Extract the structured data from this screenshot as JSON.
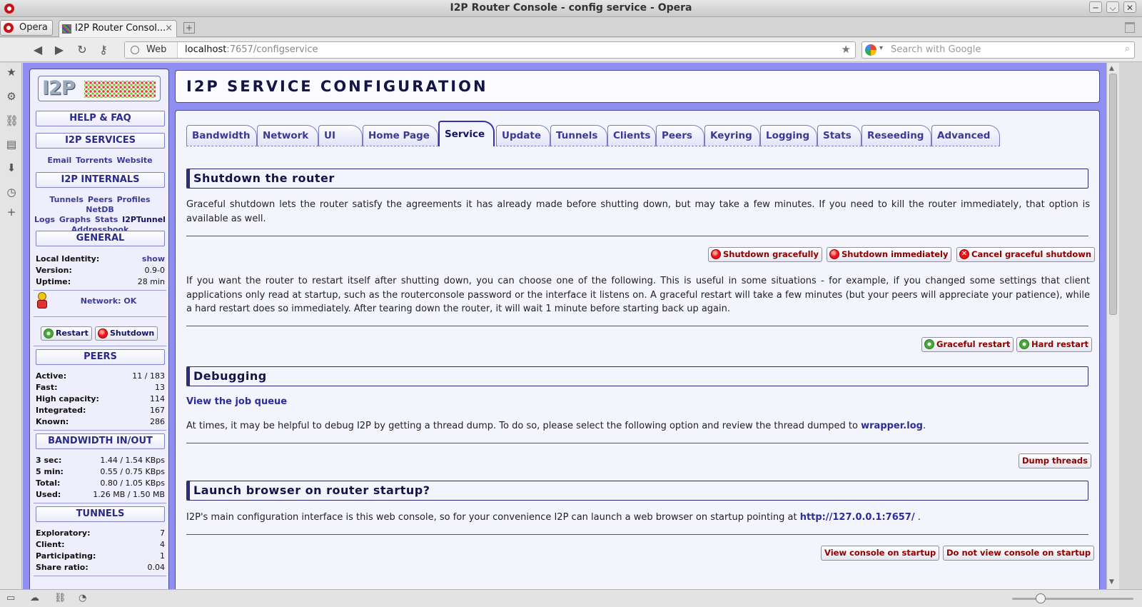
{
  "window": {
    "title": "I2P Router Console - config service - Opera",
    "controls": [
      "─",
      "⌵",
      "✕"
    ]
  },
  "browser": {
    "menu_label": "Opera",
    "tab_title": "I2P Router Consol...",
    "tab_close": "×",
    "new_tab": "+",
    "web_chip": "Web",
    "url_host": "localhost",
    "url_rest": ":7657/configservice",
    "search_placeholder": "Search with Google",
    "nav_icons": [
      "back-icon",
      "forward-icon",
      "reload-icon",
      "key-icon"
    ],
    "panel_icons": [
      "bookmarks-icon",
      "settings-icon",
      "links-icon",
      "notes-icon",
      "downloads-icon",
      "history-icon",
      "add-panel-icon"
    ]
  },
  "sidebar": {
    "help_faq": "HELP & FAQ",
    "services_header": "I2P SERVICES",
    "services": [
      "Email",
      "Torrents",
      "Website"
    ],
    "internals_header": "I2P INTERNALS",
    "internals_row1": [
      "Tunnels",
      "Peers",
      "Profiles",
      "NetDB"
    ],
    "internals_row2": [
      "Logs",
      "Graphs",
      "Stats",
      "I2PTunnel"
    ],
    "internals_row3": [
      "Addressbook"
    ],
    "general_header": "GENERAL",
    "general": [
      {
        "label": "Local Identity:",
        "value": "show"
      },
      {
        "label": "Version:",
        "value": "0.9-0"
      },
      {
        "label": "Uptime:",
        "value": "28 min"
      }
    ],
    "network_status": "Network: OK",
    "restart_label": "Restart",
    "shutdown_label": "Shutdown",
    "peers_header": "PEERS",
    "peers": [
      {
        "label": "Active:",
        "value": "11 / 183"
      },
      {
        "label": "Fast:",
        "value": "13"
      },
      {
        "label": "High capacity:",
        "value": "114"
      },
      {
        "label": "Integrated:",
        "value": "167"
      },
      {
        "label": "Known:",
        "value": "286"
      }
    ],
    "bandwidth_header": "BANDWIDTH IN/OUT",
    "bandwidth": [
      {
        "label": "3 sec:",
        "value": "1.44 / 1.54 KBps"
      },
      {
        "label": "5 min:",
        "value": "0.55 / 0.75 KBps"
      },
      {
        "label": "Total:",
        "value": "0.80 / 1.05 KBps"
      },
      {
        "label": "Used:",
        "value": "1.26 MB / 1.50 MB"
      }
    ],
    "tunnels_header": "TUNNELS",
    "tunnels": [
      {
        "label": "Exploratory:",
        "value": "7"
      },
      {
        "label": "Client:",
        "value": "4"
      },
      {
        "label": "Participating:",
        "value": "1"
      },
      {
        "label": "Share ratio:",
        "value": "0.04"
      }
    ]
  },
  "page": {
    "title": "I2P SERVICE CONFIGURATION",
    "tabs": [
      "Bandwidth",
      "Network",
      "UI",
      "Home Page",
      "Service",
      "Update",
      "Tunnels",
      "Clients",
      "Peers",
      "Keyring",
      "Logging",
      "Stats",
      "Reseeding",
      "Advanced"
    ],
    "active_tab": "Service",
    "shutdown": {
      "heading": "Shutdown the router",
      "text": "Graceful shutdown lets the router satisfy the agreements it has already made before shutting down, but may take a few minutes. If you need to kill the router immediately, that option is available as well.",
      "btn_graceful": "Shutdown gracefully",
      "btn_immediate": "Shutdown immediately",
      "btn_cancel": "Cancel graceful shutdown",
      "restart_text": "If you want the router to restart itself after shutting down, you can choose one of the following. This is useful in some situations - for example, if you changed some settings that client applications only read at startup, such as the routerconsole password or the interface it listens on. A graceful restart will take a few minutes (but your peers will appreciate your patience), while a hard restart does so immediately. After tearing down the router, it will wait 1 minute before starting back up again.",
      "btn_graceful_restart": "Graceful restart",
      "btn_hard_restart": "Hard restart"
    },
    "debugging": {
      "heading": "Debugging",
      "job_queue_link": "View the job queue",
      "text_before": "At times, it may be helpful to debug I2P by getting a thread dump. To do so, please select the following option and review the thread dumped to ",
      "log_link": "wrapper.log",
      "text_after": ".",
      "btn_dump": "Dump threads"
    },
    "browser_launch": {
      "heading": "Launch browser on router startup?",
      "text_before": "I2P's main configuration interface is this web console, so for your convenience I2P can launch a web browser on startup pointing at ",
      "url_link": "http://127.0.0.1:7657/",
      "text_after": " .",
      "btn_view": "View console on startup",
      "btn_no_view": "Do not view console on startup"
    }
  },
  "statusbar_icons": [
    "panel-toggle-icon",
    "cloud-icon",
    "share-icon",
    "speed-dial-icon"
  ]
}
